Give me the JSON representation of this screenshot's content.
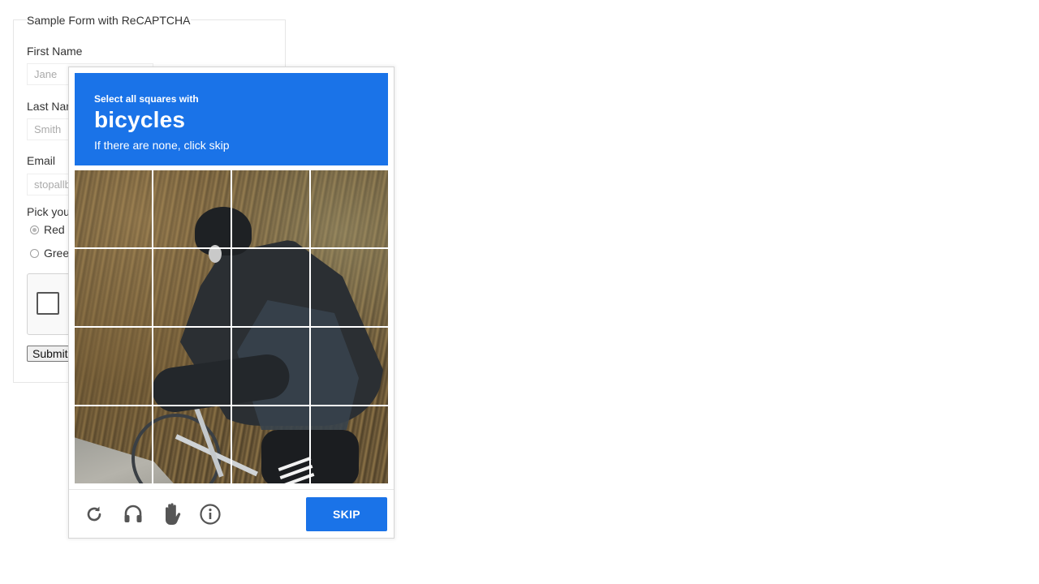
{
  "form": {
    "legend": "Sample Form with ReCAPTCHA",
    "first_name_label": "First Name",
    "first_name_placeholder": "Jane",
    "last_name_label": "Last Name",
    "last_name_placeholder": "Smith",
    "email_label": "Email",
    "email_placeholder": "stopallbots@gmail.com",
    "color_label": "Pick your favorite color:",
    "color_options": [
      "Red",
      "Green"
    ],
    "selected_color": "Red",
    "submit_label": "Submit"
  },
  "challenge": {
    "instruction_small": "Select all squares with",
    "target": "bicycles",
    "instruction_sub": "If there are none, click skip",
    "grid_rows": 4,
    "grid_cols": 4,
    "skip_label": "SKIP",
    "header_color": "#1a73e8",
    "icons": [
      "reload-icon",
      "audio-icon",
      "hand-icon",
      "info-icon"
    ]
  }
}
